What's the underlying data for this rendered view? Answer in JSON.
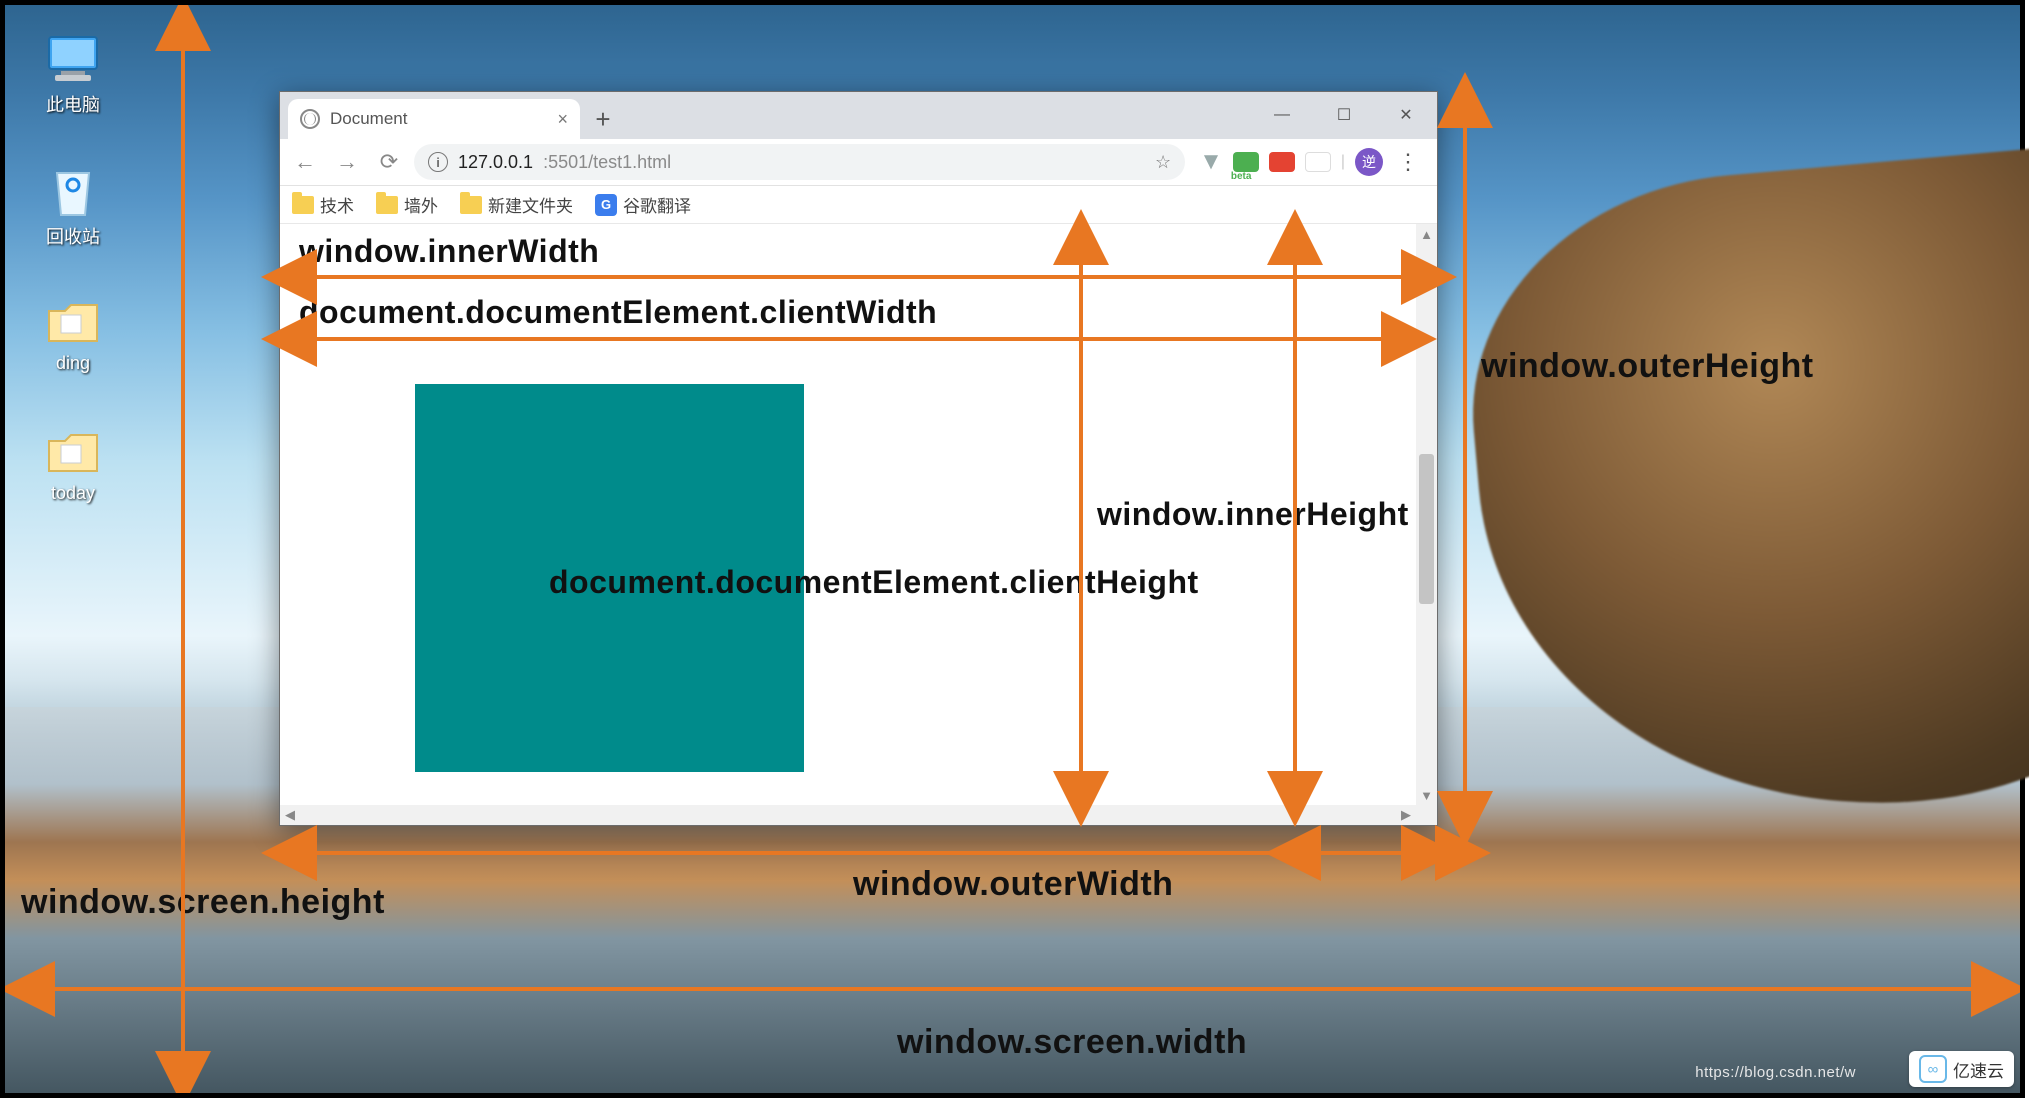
{
  "desktop_icons": [
    {
      "label": "此电脑"
    },
    {
      "label": "回收站"
    },
    {
      "label": "ding"
    },
    {
      "label": "today"
    }
  ],
  "browser": {
    "tab_title": "Document",
    "url_full": "127.0.0.1:5501/test1.html",
    "url_host": "127.0.0.1",
    "url_port_path": ":5501/test1.html",
    "bookmarks": [
      {
        "label": "技术",
        "type": "folder"
      },
      {
        "label": "墙外",
        "type": "folder"
      },
      {
        "label": "新建文件夹",
        "type": "folder"
      },
      {
        "label": "谷歌翻译",
        "type": "gt"
      }
    ],
    "chrome_extensions_beta_label": "beta"
  },
  "labels": {
    "innerWidth": "window.innerWidth",
    "clientWidth": "document.documentElement.clientWidth",
    "innerHeight": "window.innerHeight",
    "clientHeight": "document.documentElement.clientHeight",
    "outerHeight": "window.outerHeight",
    "outerWidth": "window.outerWidth",
    "screenHeight": "window.screen.height",
    "screenWidth": "window.screen.width"
  },
  "colors": {
    "arrow": "#e87722",
    "teal": "#008b8b"
  },
  "watermark": {
    "text": "亿速云",
    "url_fragment": "https://blog.csdn.net/w"
  }
}
